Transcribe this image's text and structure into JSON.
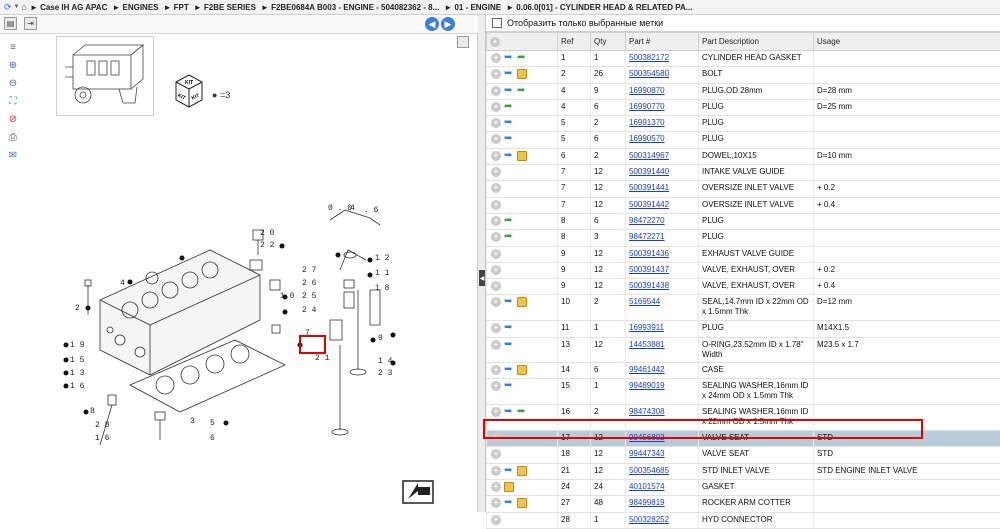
{
  "breadcrumb": [
    "Case IH AG APAC",
    "ENGINES",
    "FPT",
    "F2BE SERIES",
    "F2BE0684A B003 - ENGINE - 504082362 - 8...",
    "01 - ENGINE",
    "0.06.0[01] - CYLINDER HEAD & RELATED PA..."
  ],
  "breadcrumb_separator": "►",
  "nav_icons": [
    "refresh-icon",
    "dropdown-icon",
    "home-icon"
  ],
  "left_toolbar": {
    "icons": [
      "print-preview-icon",
      "next-page-icon",
      "back-arrow-icon",
      "forward-arrow-icon",
      "window-icon"
    ],
    "vertical_tools": [
      "zoom-in-icon",
      "zoom-out-icon",
      "fit-page-icon",
      "clear-highlight-icon",
      "print-icon",
      "email-icon"
    ]
  },
  "kit": {
    "label": "KIT",
    "quantity": "=3"
  },
  "diagram_callouts": [
    "0 . 0 4 . 6",
    "2 0",
    "2 2",
    "2 7",
    "2 6",
    "2 5",
    "2 4",
    "1 0",
    "1 2",
    "1 1",
    "1 8",
    "9",
    "1 7",
    "2 1",
    "1 4",
    "2 3",
    "2",
    "4",
    "1 9",
    "1 5",
    "1 3",
    "1 6",
    "2 8",
    "3",
    "5",
    "6",
    "7",
    "8",
    "1"
  ],
  "filter": {
    "label": "Отобразить только выбранные метки"
  },
  "table": {
    "columns": [
      "",
      "Ref",
      "Qty",
      "Part #",
      "Part Description",
      "Usage"
    ],
    "rows": [
      {
        "icons": [
          "plus",
          "info",
          "link"
        ],
        "ref": "1",
        "qty": "1",
        "part": "500382172",
        "desc": "CYLINDER HEAD GASKET",
        "usage": ""
      },
      {
        "icons": [
          "plus",
          "info",
          "pkg"
        ],
        "ref": "2",
        "qty": "26",
        "part": "500354580",
        "desc": "BOLT",
        "usage": ""
      },
      {
        "icons": [
          "plus",
          "info",
          "link"
        ],
        "ref": "4",
        "qty": "9",
        "part": "16990870",
        "desc": "PLUG,OD 28mm",
        "usage": "D=28 mm"
      },
      {
        "icons": [
          "plus",
          "link"
        ],
        "ref": "4",
        "qty": "6",
        "part": "16990770",
        "desc": "PLUG",
        "usage": "D=25 mm"
      },
      {
        "icons": [
          "plus",
          "info"
        ],
        "ref": "5",
        "qty": "2",
        "part": "16991370",
        "desc": "PLUG",
        "usage": ""
      },
      {
        "icons": [
          "plus",
          "info"
        ],
        "ref": "5",
        "qty": "6",
        "part": "16990570",
        "desc": "PLUG",
        "usage": ""
      },
      {
        "icons": [
          "plus",
          "info",
          "pkg"
        ],
        "ref": "6",
        "qty": "2",
        "part": "500314967",
        "desc": "DOWEL,10X15",
        "usage": "D=10 mm"
      },
      {
        "icons": [
          "plus"
        ],
        "ref": "7",
        "qty": "12",
        "part": "500391440",
        "desc": "INTAKE VALVE GUIDE",
        "usage": ""
      },
      {
        "icons": [
          "plus"
        ],
        "ref": "7",
        "qty": "12",
        "part": "500391441",
        "desc": "OVERSIZE INLET VALVE",
        "usage": "+ 0.2"
      },
      {
        "icons": [
          "plus"
        ],
        "ref": "7",
        "qty": "12",
        "part": "500391442",
        "desc": "OVERSIZE INLET VALVE",
        "usage": "+ 0.4"
      },
      {
        "icons": [
          "plus",
          "link"
        ],
        "ref": "8",
        "qty": "6",
        "part": "98472270",
        "desc": "PLUG",
        "usage": ""
      },
      {
        "icons": [
          "plus",
          "link"
        ],
        "ref": "8",
        "qty": "3",
        "part": "98472271",
        "desc": "PLUG",
        "usage": ""
      },
      {
        "icons": [
          "plus"
        ],
        "ref": "9",
        "qty": "12",
        "part": "500391436",
        "desc": "EXHAUST VALVE GUIDE",
        "usage": ""
      },
      {
        "icons": [
          "plus"
        ],
        "ref": "9",
        "qty": "12",
        "part": "500391437",
        "desc": "VALVE, EXHAUST, OVER",
        "usage": "+ 0.2"
      },
      {
        "icons": [
          "plus"
        ],
        "ref": "9",
        "qty": "12",
        "part": "500391438",
        "desc": "VALVE, EXHAUST, OVER",
        "usage": "+ 0.4"
      },
      {
        "icons": [
          "plus",
          "info",
          "pkg"
        ],
        "ref": "10",
        "qty": "2",
        "part": "5169544",
        "desc": "SEAL,14.7mm ID x 22mm OD x 1.5mm Thk",
        "usage": "D=12 mm",
        "tall": true
      },
      {
        "icons": [
          "plus",
          "info"
        ],
        "ref": "11",
        "qty": "1",
        "part": "16993911",
        "desc": "PLUG",
        "usage": "M14X1.5"
      },
      {
        "icons": [
          "plus",
          "info"
        ],
        "ref": "13",
        "qty": "12",
        "part": "14453881",
        "desc": "O-RING,23.52mm ID x 1.78\" Width",
        "usage": "M23.5 x 1.7"
      },
      {
        "icons": [
          "plus",
          "info",
          "pkg"
        ],
        "ref": "14",
        "qty": "6",
        "part": "99461442",
        "desc": "CASE",
        "usage": ""
      },
      {
        "icons": [
          "plus",
          "info"
        ],
        "ref": "15",
        "qty": "1",
        "part": "99489019",
        "desc": "SEALING WASHER,16mm ID x 24mm OD x 1.5mm Thk",
        "usage": "",
        "tall": true
      },
      {
        "icons": [
          "plus",
          "info",
          "link"
        ],
        "ref": "16",
        "qty": "2",
        "part": "98474308",
        "desc": "SEALING WASHER,16mm ID x 22mm OD x 1.5mm Thk",
        "usage": "",
        "tall": true
      },
      {
        "icons": [
          "plus"
        ],
        "ref": "17",
        "qty": "12",
        "part": "99456802",
        "desc": "VALVE SEAT",
        "usage": "STD",
        "selected": true
      },
      {
        "icons": [
          "plus"
        ],
        "ref": "18",
        "qty": "12",
        "part": "99447343",
        "desc": "VALVE SEAT",
        "usage": "STD"
      },
      {
        "icons": [
          "plus",
          "info",
          "pkg"
        ],
        "ref": "21",
        "qty": "12",
        "part": "500354685",
        "desc": "STD INLET VALVE",
        "usage": "STD ENGINE INLET VALVE"
      },
      {
        "icons": [
          "plus",
          "pkg"
        ],
        "ref": "24",
        "qty": "24",
        "part": "40101574",
        "desc": "GASKET",
        "usage": ""
      },
      {
        "icons": [
          "plus",
          "info",
          "pkg"
        ],
        "ref": "27",
        "qty": "48",
        "part": "98499819",
        "desc": "ROCKER ARM COTTER",
        "usage": ""
      },
      {
        "icons": [
          "plus"
        ],
        "ref": "28",
        "qty": "1",
        "part": "500328252",
        "desc": "HYD CONNECTOR",
        "usage": ""
      }
    ]
  }
}
